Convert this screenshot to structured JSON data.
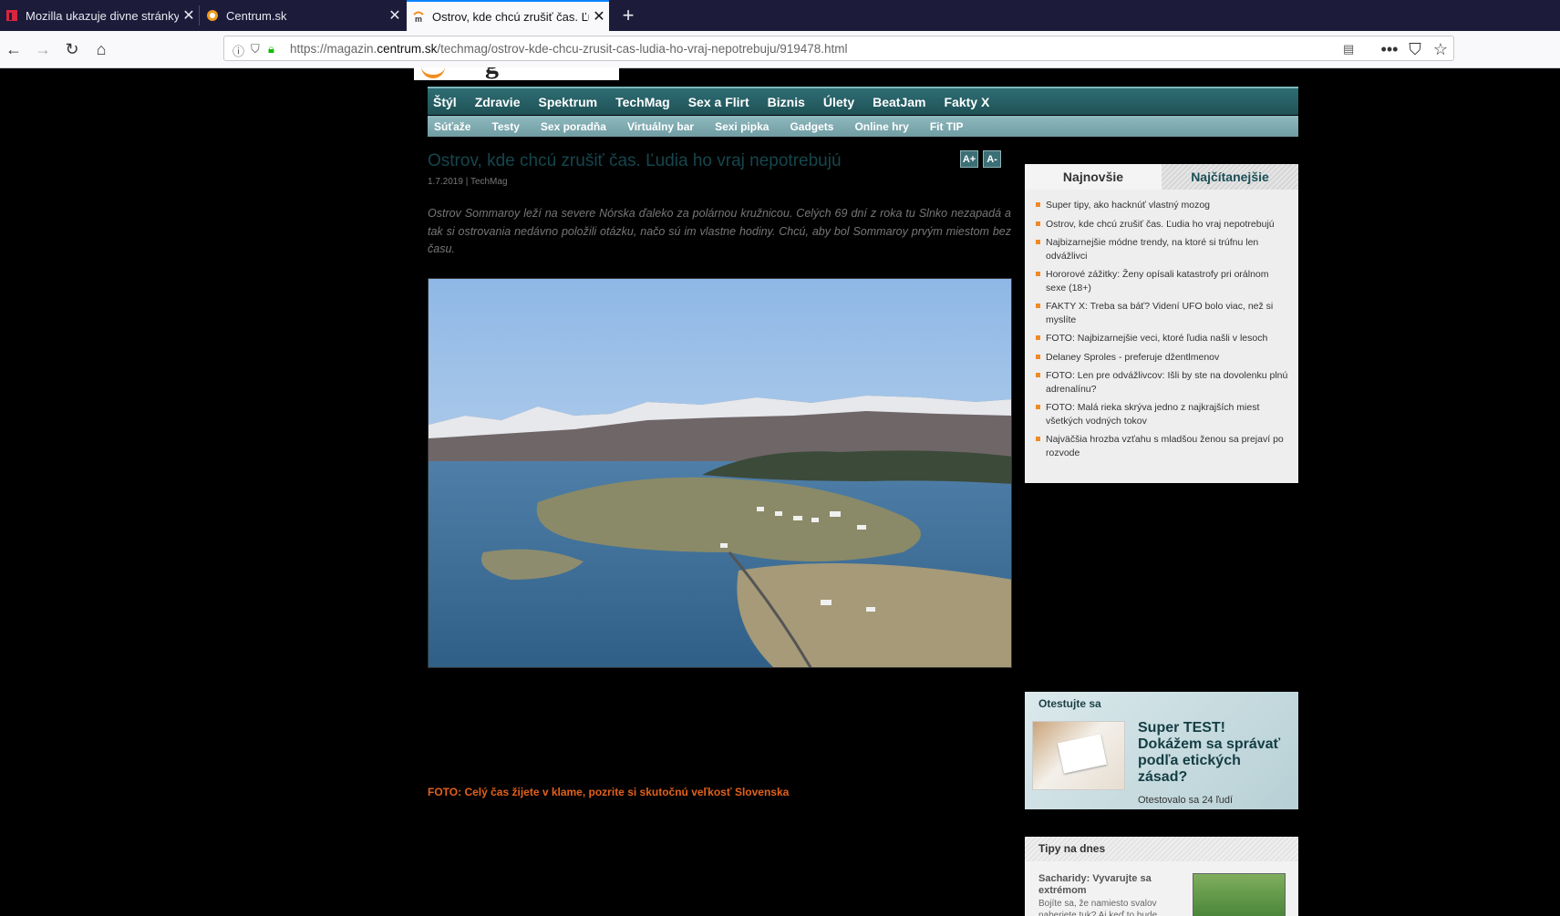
{
  "browser": {
    "tabs": [
      {
        "title": "Mozilla ukazuje divne stránky – ",
        "active": false
      },
      {
        "title": "Centrum.sk",
        "active": false
      },
      {
        "title": "Ostrov, kde chcú zrušiť čas. Ľud",
        "active": true
      }
    ],
    "url_prefix": "https://magazin.",
    "url_domain": "centrum.sk",
    "url_path": "/techmag/ostrov-kde-chcu-zrusit-cas-ludia-ho-vraj-nepotrebuju/919478.html"
  },
  "nav": {
    "main": [
      "Štýl",
      "Zdravie",
      "Spektrum",
      "TechMag",
      "Sex a Flirt",
      "Biznis",
      "Úlety",
      "BeatJam",
      "Fakty X"
    ],
    "sub": [
      "Súťaže",
      "Testy",
      "Sex poradňa",
      "Virtuálny bar",
      "Sexi pipka",
      "Gadgets",
      "Online hry",
      "Fit TIP"
    ]
  },
  "article": {
    "title": "Ostrov, kde chcú zrušiť čas. Ľudia ho vraj nepotrebujú",
    "date": "1.7.2019",
    "separator": "|",
    "section": "TechMag",
    "font_up": "A+",
    "font_down": "A-",
    "lead": "Ostrov Sommaroy leží na severe Nórska ďaleko za polárnou kružnicou. Celých 69 dní z roka tu Slnko nezapadá a tak si ostrovania nedávno položili otázku, načo sú im vlastne hodiny. Chcú, aby bol Sommaroy prvým miestom bez času.",
    "related": "FOTO: Celý čas žijete v klame, pozrite si skutočnú veľkosť Slovenska"
  },
  "sidebar": {
    "tab_newest": "Najnovšie",
    "tab_most_read": "Najčítanejšie",
    "items": [
      "Super tipy, ako hacknúť vlastný mozog",
      "Ostrov, kde chcú zrušiť čas. Ľudia ho vraj nepotrebujú",
      "Najbizarnejšie módne trendy, na ktoré si trúfnu len odvážlivci",
      "Hororové zážitky: Ženy opísali katastrofy pri orálnom sexe (18+)",
      "FAKTY X: Treba sa báť? Videní UFO bolo viac, než si myslíte",
      "FOTO: Najbizarnejšie veci, ktoré ľudia našli v lesoch",
      "Delaney Sproles - preferuje džentlmenov",
      "FOTO: Len pre odvážlivcov: Išli by ste na dovolenku plnú adrenalínu?",
      "FOTO: Malá rieka skrýva jedno z najkrajších miest všetkých vodných tokov",
      "Najväčšia hrozba vzťahu s mladšou ženou sa prejaví po rozvode"
    ],
    "test": {
      "label": "Otestujte sa",
      "title": "Super TEST! Dokážem sa správať podľa etických zásad?",
      "count": "Otestovalo sa 24 ľudí"
    },
    "tips": {
      "label": "Tipy na dnes",
      "title": "Sacharidy: Vyvarujte sa extrémom",
      "desc": "Bojíte sa, že namiesto svalov naberiete tuk? Aj keď to bude"
    }
  },
  "colors": {
    "nav_teal": "#1f5257",
    "accent_orange": "#e2611b",
    "firefox_blue": "#0a84ff"
  }
}
